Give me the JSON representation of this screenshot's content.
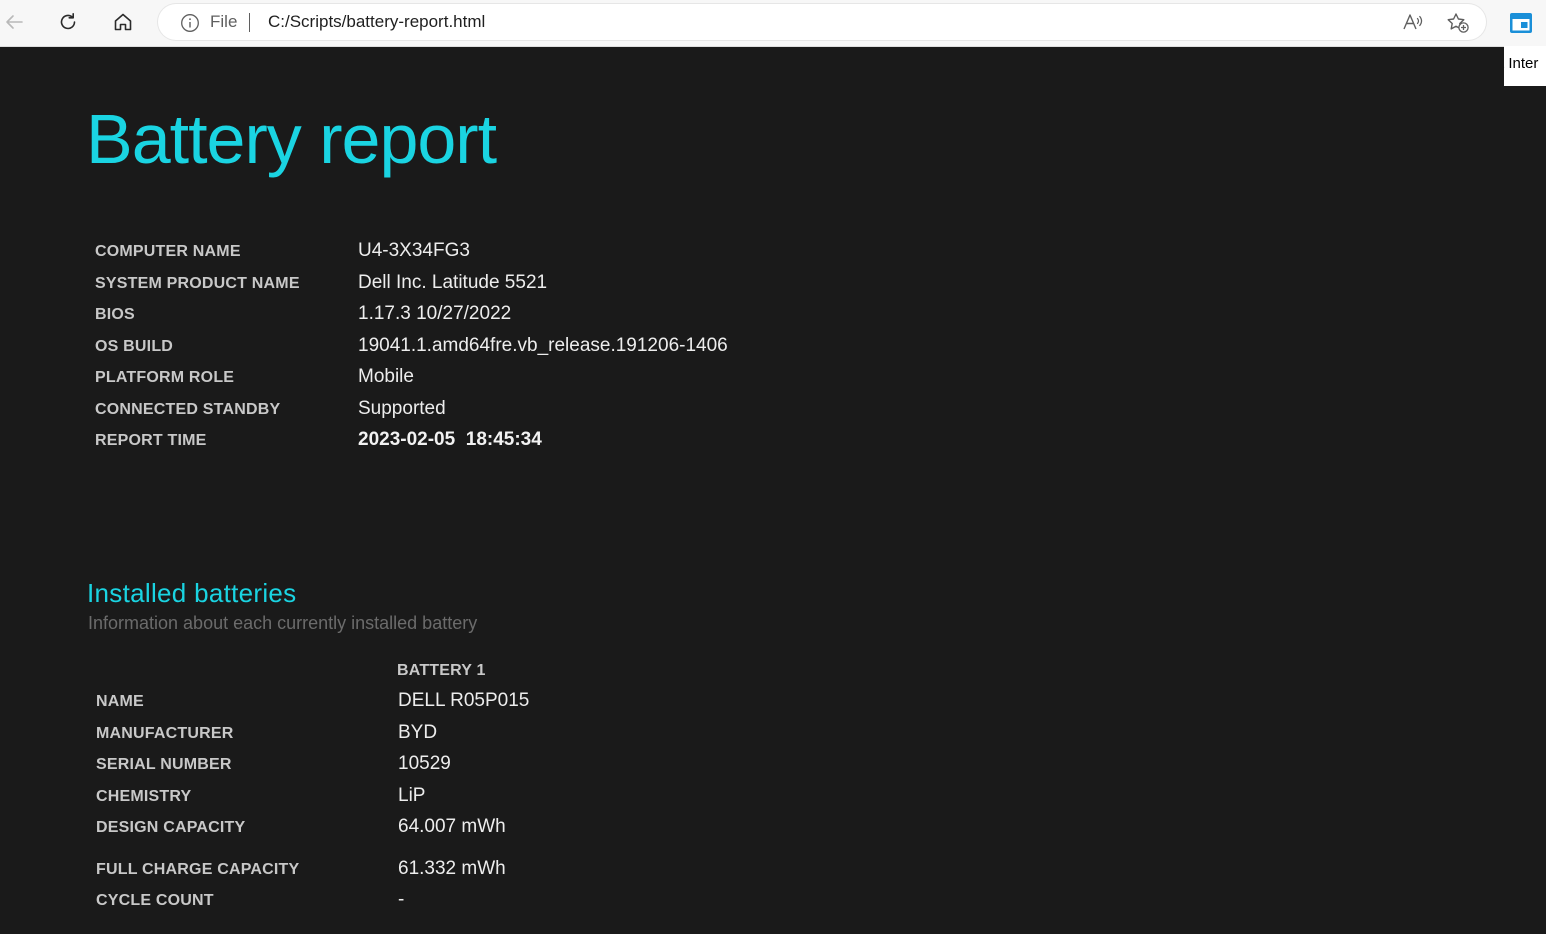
{
  "browser": {
    "address_scheme": "File",
    "url": "C:/Scripts/battery-report.html",
    "side_tab_label": "t Inter",
    "icons": [
      "back-arrow-icon",
      "refresh-icon",
      "home-icon",
      "info-icon",
      "read-aloud-icon",
      "add-favorite-icon",
      "sidebar-icon"
    ]
  },
  "report": {
    "title": "Battery report",
    "system": [
      {
        "label": "COMPUTER NAME",
        "value": "U4-3X34FG3"
      },
      {
        "label": "SYSTEM PRODUCT NAME",
        "value": "Dell Inc. Latitude 5521"
      },
      {
        "label": "BIOS",
        "value": "1.17.3 10/27/2022"
      },
      {
        "label": "OS BUILD",
        "value": "19041.1.amd64fre.vb_release.191206-1406"
      },
      {
        "label": "PLATFORM ROLE",
        "value": "Mobile"
      },
      {
        "label": "CONNECTED STANDBY",
        "value": "Supported"
      },
      {
        "label": "REPORT TIME",
        "value": "2023-02-05  18:45:34"
      }
    ],
    "installed": {
      "title": "Installed batteries",
      "subtitle": "Information about each currently installed battery",
      "column_header": "BATTERY 1",
      "rows": [
        {
          "label": "NAME",
          "value": "DELL R05P015"
        },
        {
          "label": "MANUFACTURER",
          "value": "BYD"
        },
        {
          "label": "SERIAL NUMBER",
          "value": "10529"
        },
        {
          "label": "CHEMISTRY",
          "value": "LiP"
        },
        {
          "label": "DESIGN CAPACITY",
          "value": "64.007 mWh"
        },
        {
          "label": "FULL CHARGE CAPACITY",
          "value": "61.332 mWh"
        },
        {
          "label": "CYCLE COUNT",
          "value": "-"
        }
      ]
    }
  },
  "colors": {
    "accent": "#1ad4e2",
    "background": "#1a1a1a",
    "label": "#c8c8c8",
    "value": "#ededed",
    "subtitle": "#6b6b6b"
  }
}
